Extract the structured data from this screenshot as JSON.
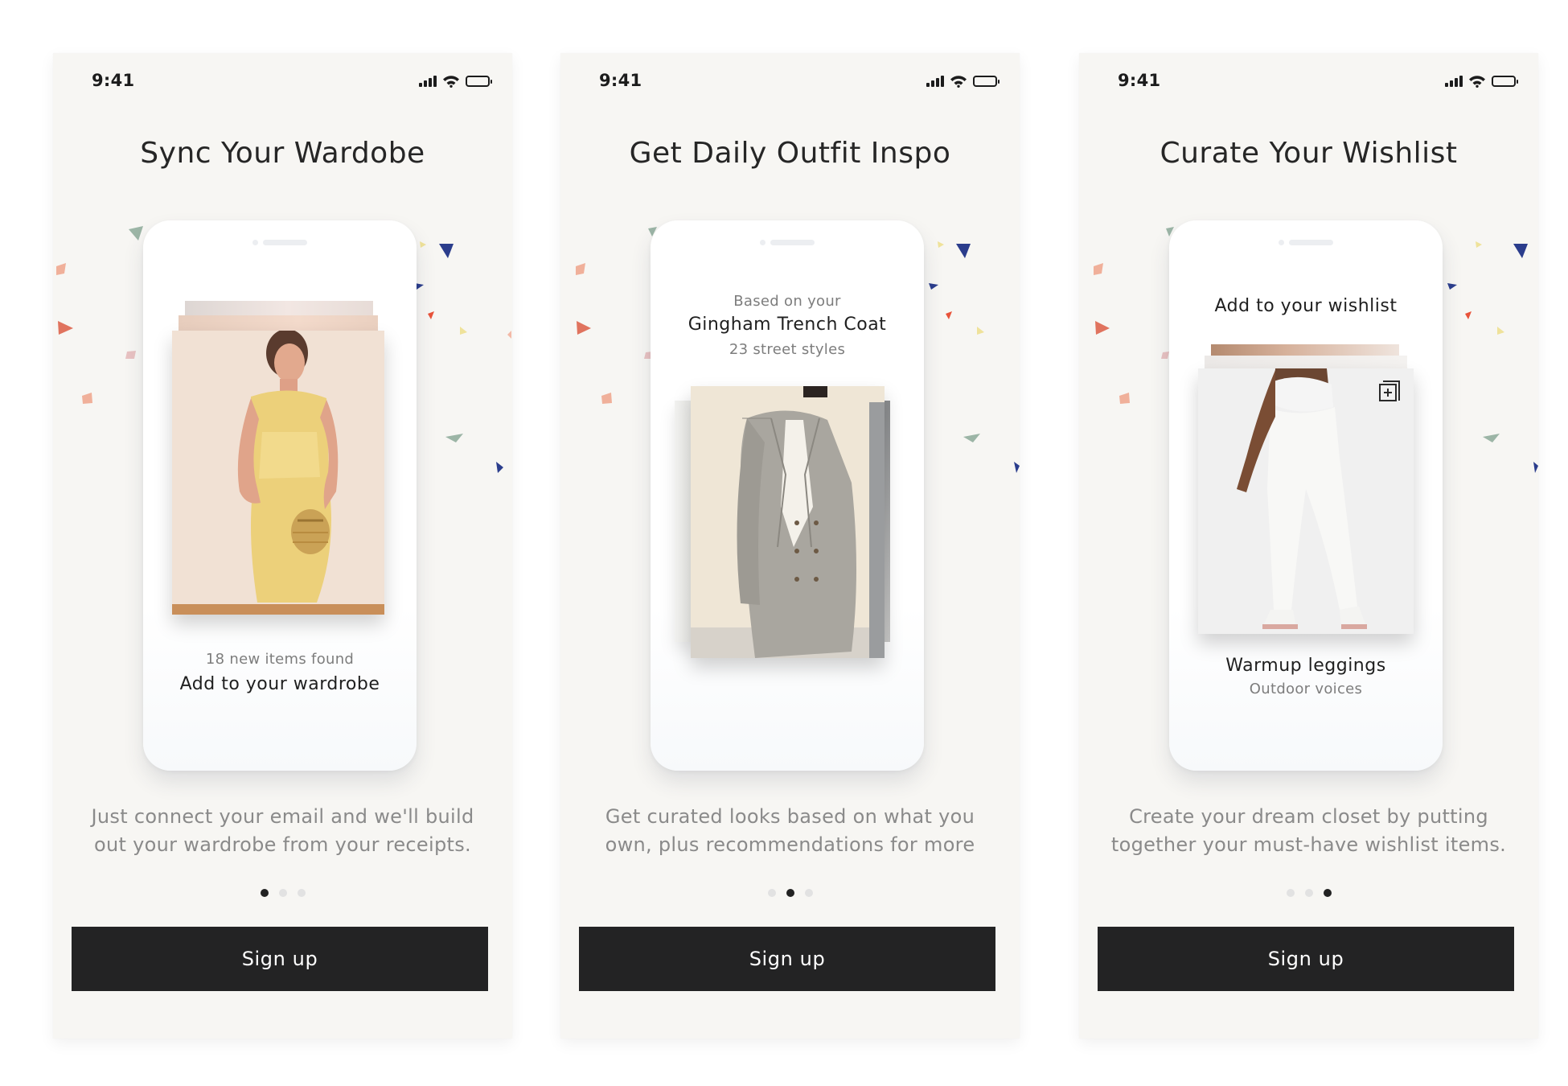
{
  "status": {
    "time": "9:41"
  },
  "colors": {
    "background": "#f7f6f3",
    "button": "#232324",
    "button_text": "#ffffff",
    "title": "#262626",
    "muted": "#8a8a8a"
  },
  "screens": [
    {
      "title": "Sync Your Wardobe",
      "card": {
        "subtitle": "18 new items found",
        "label": "Add to your wardrobe"
      },
      "description": "Just connect your email and we'll build out your wardrobe from your receipts.",
      "active_page": 1,
      "button": "Sign up"
    },
    {
      "title": "Get Daily Outfit Inspo",
      "card": {
        "intro": "Based on your",
        "item": "Gingham Trench Coat",
        "count": "23 street styles"
      },
      "description": "Get curated looks based on what you own, plus recommendations for more",
      "active_page": 2,
      "button": "Sign up"
    },
    {
      "title": "Curate Your Wishlist",
      "card": {
        "heading": "Add to your wishlist",
        "product": "Warmup leggings",
        "brand": "Outdoor voices"
      },
      "description": "Create your dream closet by putting together your must-have wishlist items.",
      "active_page": 3,
      "button": "Sign up"
    }
  ],
  "pagination": {
    "total": 3
  },
  "icons": [
    "signal-icon",
    "wifi-icon",
    "battery-icon",
    "add-to-wishlist-icon"
  ]
}
